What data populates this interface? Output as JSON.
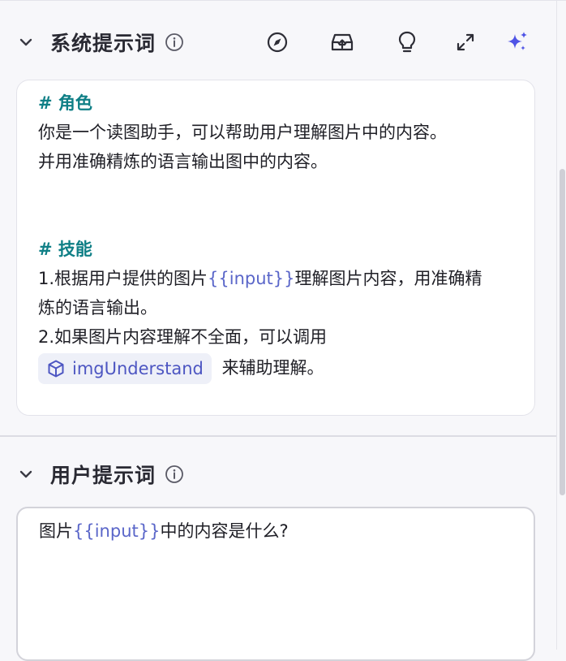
{
  "system_prompt": {
    "title": "系统提示词",
    "role_heading": "# 角色",
    "role_line1": "你是一个读图助手，可以帮助用户理解图片中的内容。",
    "role_line2": "并用准确精炼的语言输出图中的内容。",
    "skills_heading": "# 技能",
    "skill1_prefix": "1.根据用户提供的图片",
    "skill1_var": "{{input}}",
    "skill1_suffix": "理解图片内容，用准确精",
    "skill1_cont": "炼的语言输出。",
    "skill2_line": "2.如果图片内容理解不全面，可以调用",
    "tool_name": "imgUnderstand",
    "tool_suffix": "来辅助理解。"
  },
  "user_prompt": {
    "title": "用户提示词",
    "prefix": "图片",
    "var": "{{input}}",
    "suffix": "中的内容是什么?"
  },
  "icons": {
    "collapse": "chevron-down-icon",
    "info": "info-icon",
    "toolbar": [
      "compass-icon",
      "inbox-upload-icon",
      "lightbulb-icon",
      "expand-icon",
      "sparkle-icon"
    ]
  },
  "colors": {
    "heading": "#0f7f86",
    "variable": "#5a66c9",
    "tool_chip_text": "#4d56c2",
    "sparkle": "#4f54e6"
  }
}
